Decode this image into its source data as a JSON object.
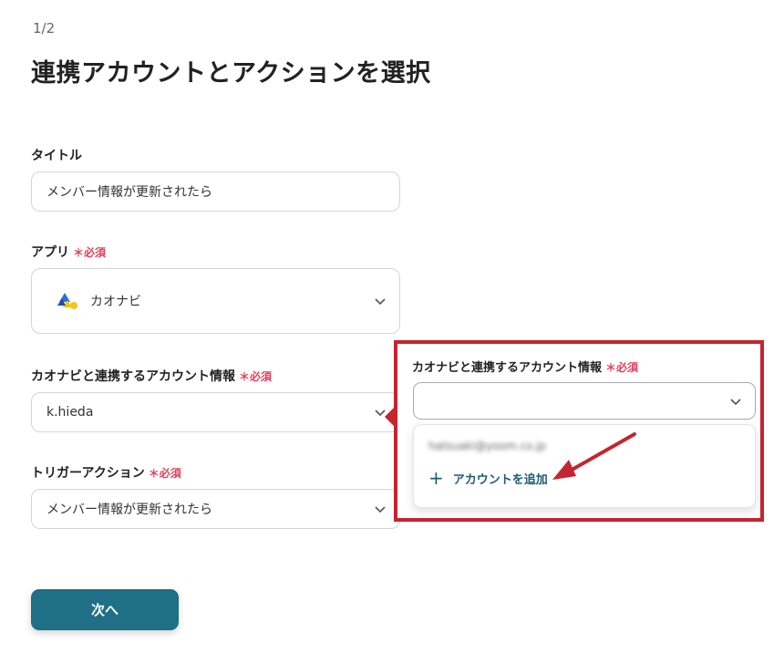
{
  "step_indicator": "1/2",
  "page_title": "連携アカウントとアクションを選択",
  "required_mark": "＊必須",
  "title_field": {
    "label": "タイトル",
    "value": "メンバー情報が更新されたら"
  },
  "app_field": {
    "label": "アプリ",
    "value": "カオナビ",
    "icon": "kaonavi-logo"
  },
  "account_field": {
    "label": "カオナビと連携するアカウント情報",
    "value": "k.hieda"
  },
  "trigger_field": {
    "label": "トリガーアクション",
    "value": "メンバー情報が更新されたら"
  },
  "callout": {
    "label": "カオナビと連携するアカウント情報",
    "select_value": "",
    "blurred_option": "hatsuaki@yoom.co.jp",
    "add_account_label": "アカウントを追加",
    "highlight_color": "#c4252f"
  },
  "next_button": "次へ",
  "colors": {
    "primary": "#1f6f86",
    "required": "#e0415a",
    "highlight": "#c4252f"
  }
}
